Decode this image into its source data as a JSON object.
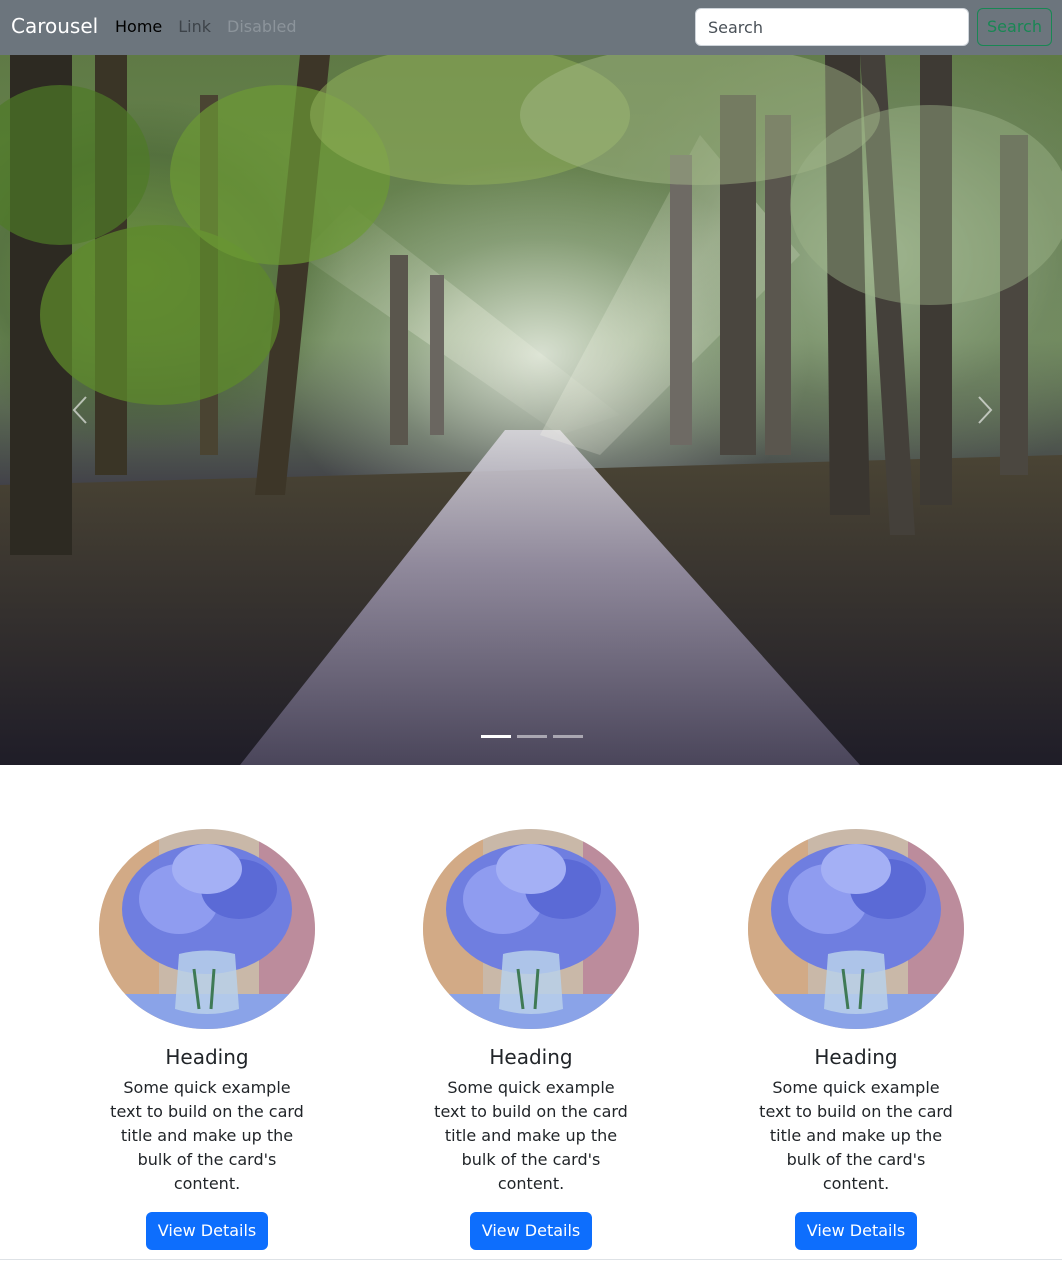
{
  "navbar": {
    "brand": "Carousel",
    "links": [
      "Home",
      "Link",
      "Disabled"
    ],
    "search_placeholder": "Search",
    "search_button": "Search",
    "bg_color": "#6c757d"
  },
  "carousel": {
    "slide_count": 3,
    "active_index": 0,
    "image": "forest-path-with-sun-rays",
    "prev_icon": "chevron-left-icon",
    "next_icon": "chevron-right-icon"
  },
  "cards": [
    {
      "heading": "Heading",
      "text": "Some quick example text to build on the card title and make up the bulk of the card's content.",
      "button": "View Details",
      "image": "blue-flowers-vase-painting"
    },
    {
      "heading": "Heading",
      "text": "Some quick example text to build on the card title and make up the bulk of the card's content.",
      "button": "View Details",
      "image": "blue-flowers-vase-painting"
    },
    {
      "heading": "Heading",
      "text": "Some quick example text to build on the card title and make up the bulk of the card's content.",
      "button": "View Details",
      "image": "blue-flowers-vase-painting"
    }
  ],
  "colors": {
    "primary": "#0d6efd",
    "success": "#198754"
  }
}
